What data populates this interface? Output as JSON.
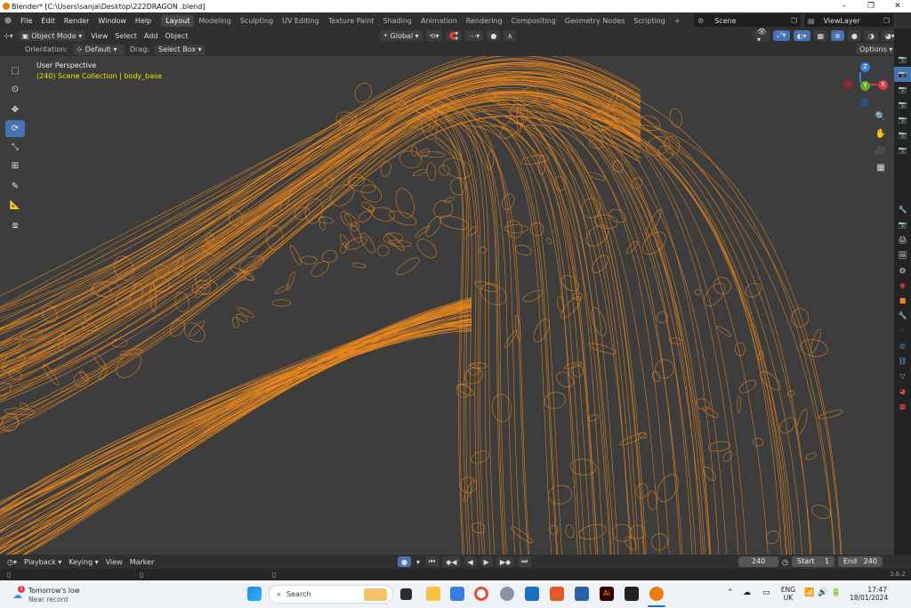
{
  "window": {
    "title": "Blender* [C:\\Users\\sanja\\Desktop\\222DRAGON .blend]",
    "minimize": "–",
    "maximize": "❐",
    "close": "✕"
  },
  "menu": {
    "items": [
      "File",
      "Edit",
      "Render",
      "Window",
      "Help"
    ],
    "workspaces": [
      "Layout",
      "Modeling",
      "Sculpting",
      "UV Editing",
      "Texture Paint",
      "Shading",
      "Animation",
      "Rendering",
      "Compositing",
      "Geometry Nodes",
      "Scripting"
    ],
    "active_workspace": "Layout",
    "add_tab": "+",
    "scene_label": "Scene",
    "viewlayer_label": "ViewLayer"
  },
  "header": {
    "mode": "Object Mode",
    "menus": [
      "View",
      "Select",
      "Add",
      "Object"
    ],
    "transform_orientation": "Global"
  },
  "tool_settings": {
    "orientation_label": "Orientation:",
    "orientation_value": "Default",
    "drag_label": "Drag:",
    "drag_value": "Select Box",
    "options": "Options"
  },
  "viewport": {
    "perspective": "User Perspective",
    "collection_info": "(240) Scene Collection | body_base",
    "wire_color": "#f08a1e",
    "background": "#3d3d3d"
  },
  "gizmo": {
    "x": "X",
    "y": "Y",
    "z": "Z"
  },
  "toolbar": {
    "tools": [
      "select-box-tool",
      "cursor-tool",
      "move-tool",
      "rotate-tool",
      "scale-tool",
      "transform-tool",
      "annotate-tool",
      "measure-tool",
      "add-cube-tool"
    ],
    "active": "rotate-tool"
  },
  "timeline": {
    "menus": [
      "Playback",
      "Keying",
      "View",
      "Marker"
    ],
    "current_frame": "240",
    "start_label": "Start",
    "start_value": "1",
    "end_label": "End",
    "end_value": "240"
  },
  "status": {
    "version": "3.6.2"
  },
  "taskbar": {
    "weather_title": "Tomorrow's low",
    "weather_sub": "Near record",
    "weather_badge": "1",
    "search": "Search",
    "lang_top": "ENG",
    "lang_bottom": "UK",
    "time": "17:47",
    "date": "18/01/2024"
  }
}
